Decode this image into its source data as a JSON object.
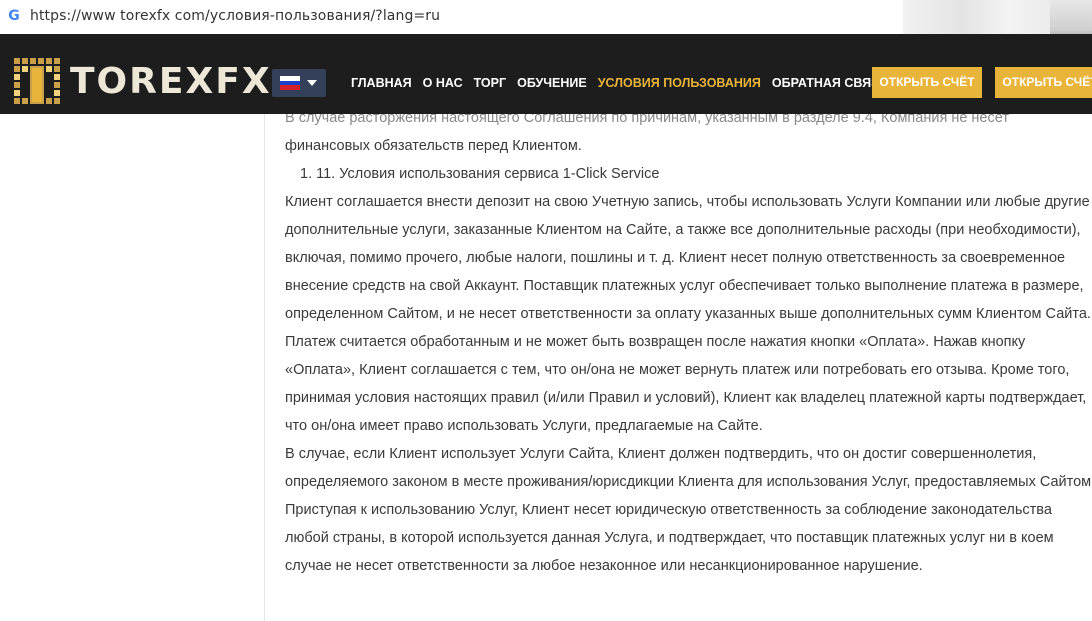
{
  "browser": {
    "url": "https://www torexfx com/условия-пользования/?lang=ru"
  },
  "header": {
    "logo_text": "TOREXFX",
    "language": "ru",
    "nav": [
      {
        "label": "ГЛАВНАЯ",
        "active": false
      },
      {
        "label": "О НАС",
        "active": false
      },
      {
        "label": "ТОРГ",
        "active": false
      },
      {
        "label": "ОБУЧЕНИЕ",
        "active": false
      },
      {
        "label": "УСЛОВИЯ ПОЛЬЗОВАНИЯ",
        "active": true
      },
      {
        "label": "ОБРАТНАЯ СВЯЗЬ",
        "active": false
      }
    ],
    "cta1": "ОТКРЫТЬ СЧЁТ",
    "cta2": "ОТКРЫТЬ СЧЁТ",
    "accent_color": "#e9b43a",
    "background_color": "#1d1d1d"
  },
  "content": {
    "cut_line": "В случае расторжения настоящего Соглашения по причинам, указанным в разделе 9.4, Компания не несет",
    "para0_end": "финансовых обязательств перед Клиентом.",
    "list_item": "1. 11. Условия использования сервиса 1-Click Service",
    "para1": "Клиент соглашается внести депозит на свою Учетную запись, чтобы использовать Услуги Компании или любые другие дополнительные услуги, заказанные Клиентом на Сайте, а также все дополнительные расходы (при необходимости), включая, помимо прочего, любые налоги, пошлины и т. д. Клиент несет полную ответственность за своевременное внесение средств на свой Аккаунт. Поставщик платежных услуг обеспечивает только выполнение платежа в размере, определенном Сайтом, и не несет ответственности за оплату указанных выше дополнительных сумм Клиентом Сайта.",
    "para2": "Платеж считается обработанным и не может быть возвращен после нажатия кнопки «Оплата». Нажав кнопку «Оплата», Клиент соглашается с тем, что он/она не может вернуть платеж или потребовать его отзыва. Кроме того, принимая условия настоящих правил (и/или Правил и условий), Клиент как владелец платежной карты подтверждает, что он/она имеет право использовать Услуги, предлагаемые на Сайте.",
    "para3": "В случае, если Клиент использует Услуги Сайта, Клиент должен подтвердить, что он достиг совершеннолетия, определяемого законом в месте проживания/юрисдикции Клиента для использования Услуг, предоставляемых Сайтом.",
    "para4": "Приступая к использованию Услуг, Клиент несет юридическую ответственность за соблюдение законодательства любой страны, в которой используется данная Услуга, и подтверждает, что поставщик платежных услуг ни в коем случае не несет ответственности за любое незаконное или несанкционированное нарушение."
  }
}
